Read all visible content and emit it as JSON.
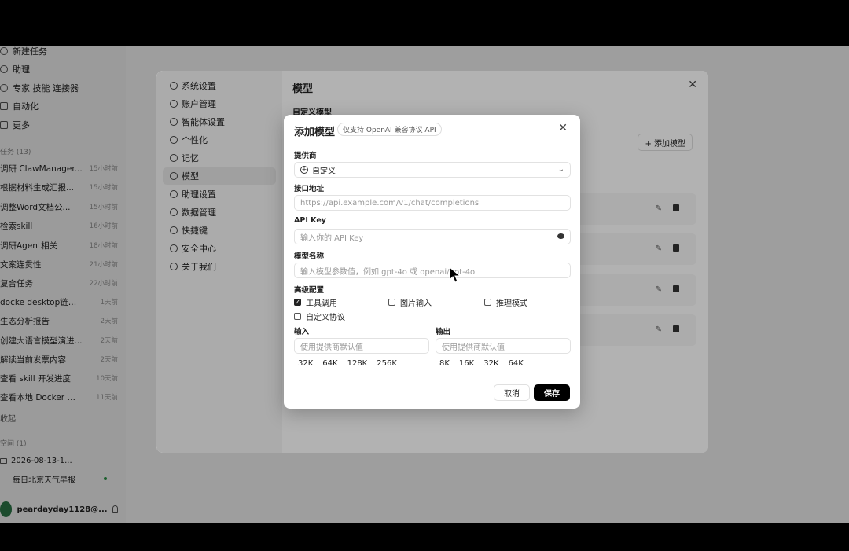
{
  "sidebar": {
    "nav": [
      {
        "label": "新建任务",
        "icon": "plus-circle-icon"
      },
      {
        "label": "助理",
        "icon": "assistant-icon"
      },
      {
        "label": "专家 技能 连接器",
        "icon": "expert-icon"
      },
      {
        "label": "自动化",
        "icon": "automation-icon"
      },
      {
        "label": "更多",
        "icon": "more-icon"
      }
    ],
    "tasks_header": "任务 (13)",
    "tasks": [
      {
        "title": "调研 ClawManager...",
        "time": "15小时前"
      },
      {
        "title": "根据材料生成汇报...",
        "time": "15小时前"
      },
      {
        "title": "调整Word文档公...",
        "time": "15小时前"
      },
      {
        "title": "检索skill",
        "time": "16小时前"
      },
      {
        "title": "调研Agent相关",
        "time": "18小时前"
      },
      {
        "title": "文案连贯性",
        "time": "21小时前"
      },
      {
        "title": "复合任务",
        "time": "22小时前"
      },
      {
        "title": "docke desktop链接问...",
        "time": "1天前"
      },
      {
        "title": "生态分析报告",
        "time": "2天前"
      },
      {
        "title": "创建大语言模型演进...",
        "time": "2天前"
      },
      {
        "title": "解读当前发票内容",
        "time": "2天前"
      },
      {
        "title": "查看 skill 开发进度",
        "time": "10天前"
      },
      {
        "title": "查看本地 Docker 镜像",
        "time": "11天前"
      }
    ],
    "collapse": "收起",
    "spaces_header": "空间 (1)",
    "space_folder": "2026-08-13-1...",
    "space_item": "每日北京天气早报",
    "user": "peardayday1128@..."
  },
  "settings": {
    "menu": [
      {
        "label": "系统设置",
        "icon": "gear-icon"
      },
      {
        "label": "账户管理",
        "icon": "user-icon"
      },
      {
        "label": "智能体设置",
        "icon": "agent-icon"
      },
      {
        "label": "个性化",
        "icon": "palette-icon"
      },
      {
        "label": "记忆",
        "icon": "memory-icon"
      },
      {
        "label": "模型",
        "icon": "cube-icon"
      },
      {
        "label": "助理设置",
        "icon": "assistant-settings-icon"
      },
      {
        "label": "数据管理",
        "icon": "database-icon"
      },
      {
        "label": "快捷键",
        "icon": "keyboard-icon"
      },
      {
        "label": "安全中心",
        "icon": "shield-icon"
      },
      {
        "label": "关于我们",
        "icon": "info-icon"
      }
    ],
    "active_index": 5,
    "title": "模型",
    "custom_models_label": "自定义模型",
    "add_model_button": "+ 添加模型"
  },
  "modal": {
    "title": "添加模型",
    "tag": "仅支持 OpenAI 兼容协议 API",
    "provider_label": "提供商",
    "provider_value": "自定义",
    "endpoint_label": "接口地址",
    "endpoint_placeholder": "https://api.example.com/v1/chat/completions",
    "apikey_label": "API Key",
    "apikey_placeholder": "输入你的 API Key",
    "model_name_label": "模型名称",
    "model_name_placeholder": "输入模型参数值，例如 gpt-4o 或 openai/gpt-4o",
    "advanced_label": "高级配置",
    "options": [
      {
        "label": "工具调用",
        "checked": true
      },
      {
        "label": "图片输入",
        "checked": false
      },
      {
        "label": "推理模式",
        "checked": false
      },
      {
        "label": "自定义协议",
        "checked": false
      }
    ],
    "input_label": "输入",
    "output_label": "输出",
    "input_placeholder": "使用提供商默认值",
    "output_placeholder": "使用提供商默认值",
    "input_chips": [
      "32K",
      "64K",
      "128K",
      "256K"
    ],
    "output_chips": [
      "8K",
      "16K",
      "32K",
      "64K"
    ],
    "cancel": "取消",
    "save": "保存"
  }
}
